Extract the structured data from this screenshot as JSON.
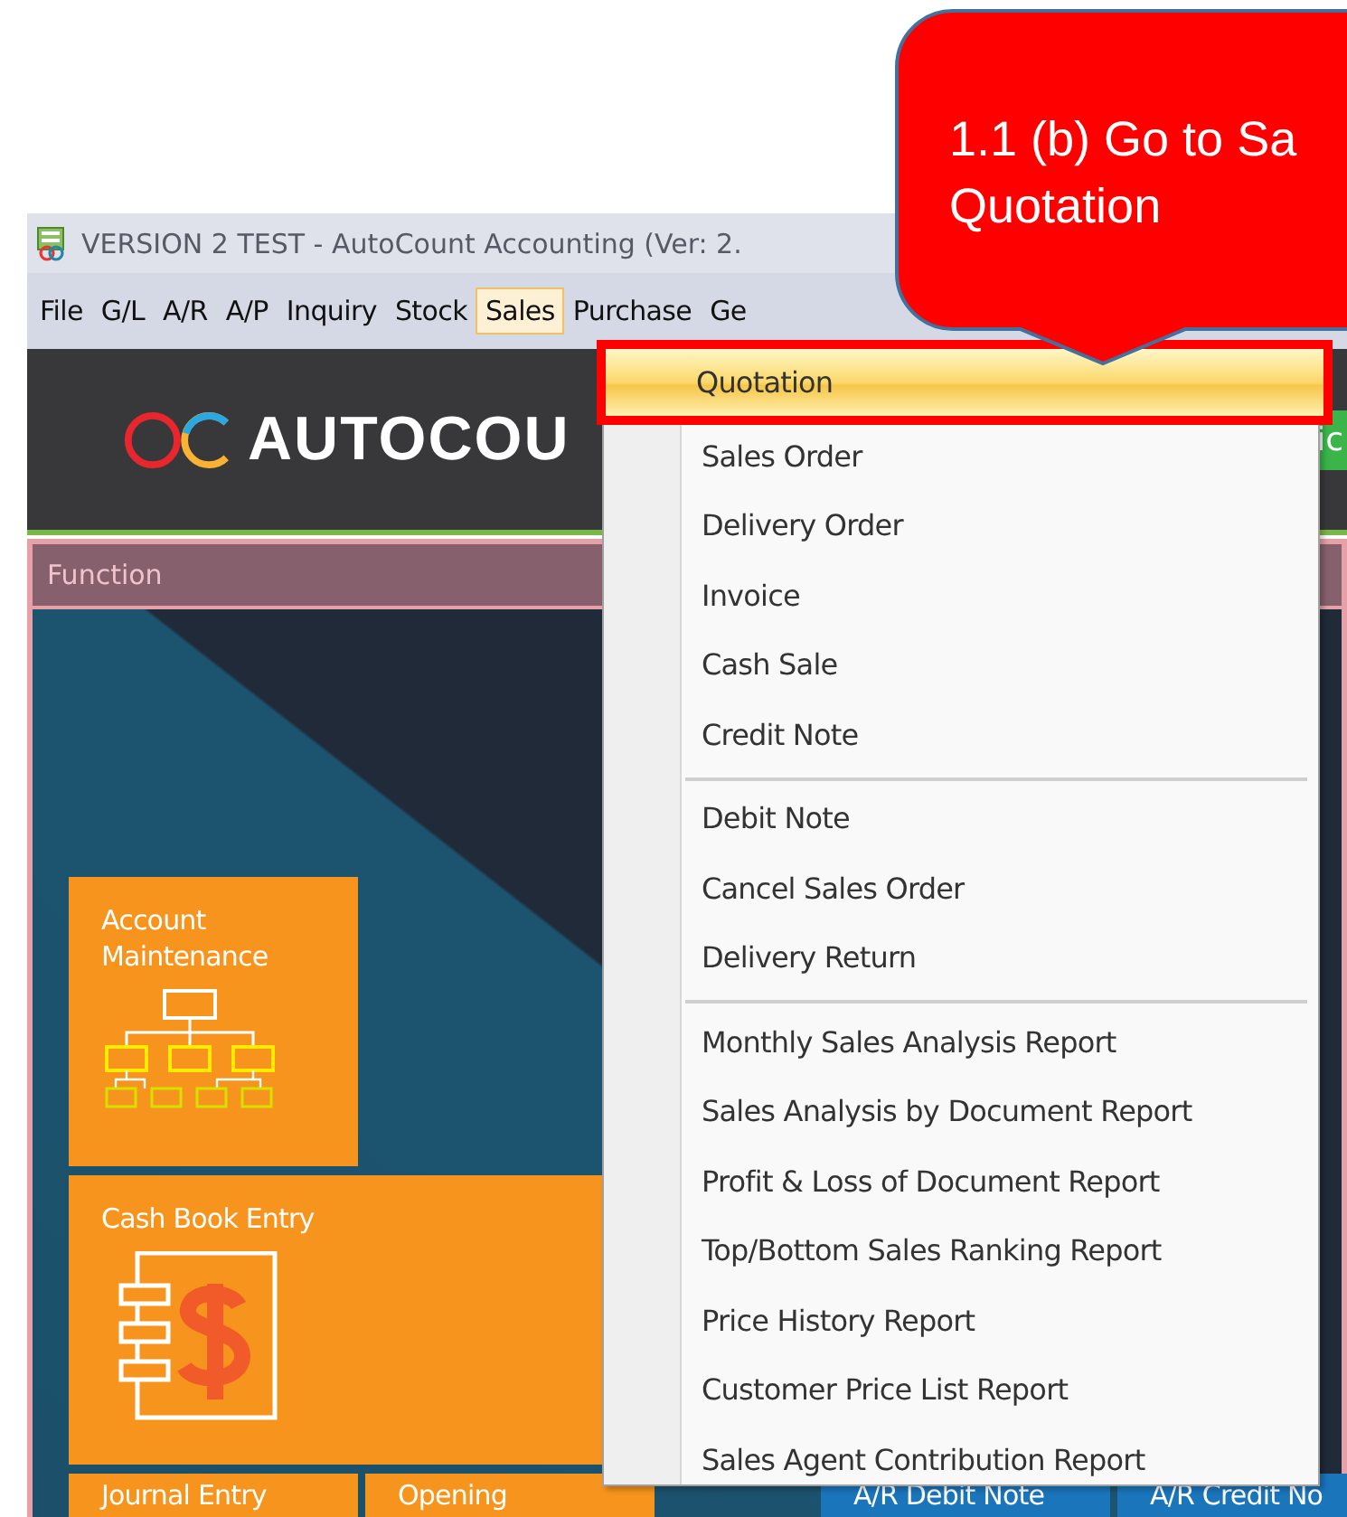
{
  "window": {
    "title": "VERSION 2 TEST - AutoCount Accounting (Ver: 2."
  },
  "menu_bar": [
    {
      "label": "File",
      "selected": false
    },
    {
      "label": "G/L",
      "selected": false
    },
    {
      "label": "A/R",
      "selected": false
    },
    {
      "label": "A/P",
      "selected": false
    },
    {
      "label": "Inquiry",
      "selected": false
    },
    {
      "label": "Stock",
      "selected": false
    },
    {
      "label": "Sales",
      "selected": true
    },
    {
      "label": "Purchase",
      "selected": false
    },
    {
      "label": "Ge",
      "selected": false
    }
  ],
  "header": {
    "logo_text": "AUTOCOU",
    "side_tab": "ic"
  },
  "function_panel": {
    "title": "Function",
    "tiles": [
      {
        "label": "Account Maintenance",
        "kind": "tree",
        "color": "#f7941d"
      },
      {
        "label": "Cash Book Entry",
        "kind": "ledger",
        "color": "#f7941d"
      },
      {
        "label": "Journal Entry",
        "kind": "plain",
        "color": "#f7941d"
      },
      {
        "label": "Opening",
        "kind": "plain",
        "color": "#f7941d"
      },
      {
        "label": "A/R Debit Note",
        "kind": "plain",
        "color": "#1b75bb"
      },
      {
        "label": "A/R Credit No",
        "kind": "plain",
        "color": "#1b75bb"
      }
    ]
  },
  "sales_menu": {
    "groups": [
      [
        {
          "label": "Quotation",
          "selected": true
        },
        {
          "label": "Sales Order",
          "selected": false
        },
        {
          "label": "Delivery Order",
          "selected": false
        },
        {
          "label": "Invoice",
          "selected": false
        },
        {
          "label": "Cash Sale",
          "selected": false
        },
        {
          "label": "Credit Note",
          "selected": false
        }
      ],
      [
        {
          "label": "Debit Note",
          "selected": false
        },
        {
          "label": "Cancel Sales Order",
          "selected": false
        },
        {
          "label": "Delivery Return",
          "selected": false
        }
      ],
      [
        {
          "label": "Monthly Sales Analysis Report",
          "selected": false
        },
        {
          "label": "Sales Analysis by Document Report",
          "selected": false
        },
        {
          "label": "Profit & Loss of Document Report",
          "selected": false
        },
        {
          "label": "Top/Bottom Sales Ranking Report",
          "selected": false
        },
        {
          "label": "Price History Report",
          "selected": false
        },
        {
          "label": "Customer Price List Report",
          "selected": false
        },
        {
          "label": "Sales Agent Contribution Report",
          "selected": false
        }
      ]
    ]
  },
  "callout": {
    "lines": [
      "1.1 (b) Go to Sa",
      "Quotation"
    ]
  }
}
